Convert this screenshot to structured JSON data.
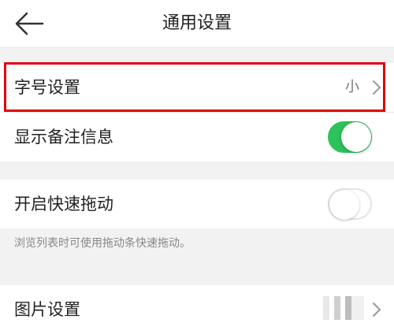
{
  "header": {
    "title": "通用设置",
    "back_icon": "arrow-left-icon"
  },
  "settings": {
    "font_size": {
      "label": "字号设置",
      "value": "小",
      "highlighted": true,
      "highlight_color": "#e00010"
    },
    "show_notes": {
      "label": "显示备注信息",
      "enabled": true
    },
    "quick_drag": {
      "label": "开启快速拖动",
      "enabled": false,
      "hint": "浏览列表时可使用拖动条快速拖动。"
    },
    "image_settings": {
      "label": "图片设置"
    }
  },
  "colors": {
    "toggle_on": "#2dc35a",
    "background": "#f2f2f2"
  }
}
